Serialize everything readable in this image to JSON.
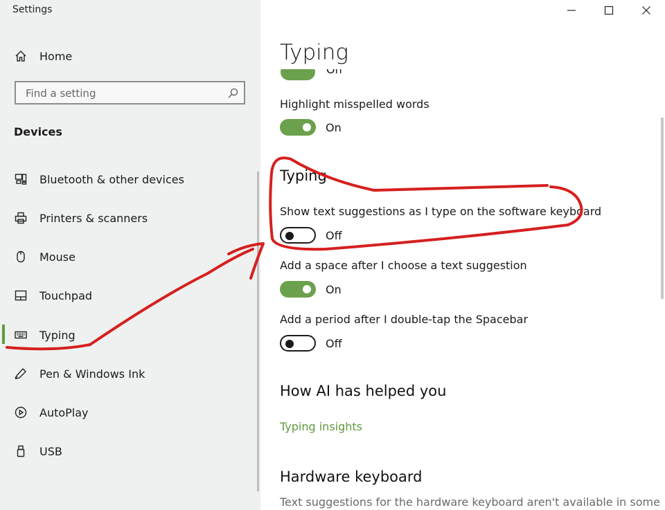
{
  "window": {
    "title": "Settings"
  },
  "sidebar": {
    "home_label": "Home",
    "search_placeholder": "Find a setting",
    "section_heading": "Devices",
    "items": [
      {
        "label": "Bluetooth & other devices",
        "icon": "bluetooth-devices-icon"
      },
      {
        "label": "Printers & scanners",
        "icon": "printer-icon"
      },
      {
        "label": "Mouse",
        "icon": "mouse-icon"
      },
      {
        "label": "Touchpad",
        "icon": "touchpad-icon"
      },
      {
        "label": "Typing",
        "icon": "keyboard-icon",
        "active": true
      },
      {
        "label": "Pen & Windows Ink",
        "icon": "pen-icon"
      },
      {
        "label": "AutoPlay",
        "icon": "autoplay-icon"
      },
      {
        "label": "USB",
        "icon": "usb-icon"
      }
    ]
  },
  "content": {
    "page_title": "Typing",
    "partial_toggle_state": "On",
    "spelling_settings": [
      {
        "label": "Highlight misspelled words",
        "state": "On"
      }
    ],
    "typing_section": {
      "heading": "Typing",
      "settings": [
        {
          "label": "Show text suggestions as I type on the software keyboard",
          "state": "Off"
        },
        {
          "label": "Add a space after I choose a text suggestion",
          "state": "On"
        },
        {
          "label": "Add a period after I double-tap the Spacebar",
          "state": "Off"
        }
      ]
    },
    "ai_section": {
      "heading": "How AI has helped you",
      "link": "Typing insights"
    },
    "hardware_section": {
      "heading": "Hardware keyboard",
      "description": "Text suggestions for the hardware keyboard aren't available in some"
    }
  },
  "colors": {
    "accent": "#6ba04c",
    "sidebar_bg": "#eef1ef",
    "annotation": "#d61f1f"
  }
}
